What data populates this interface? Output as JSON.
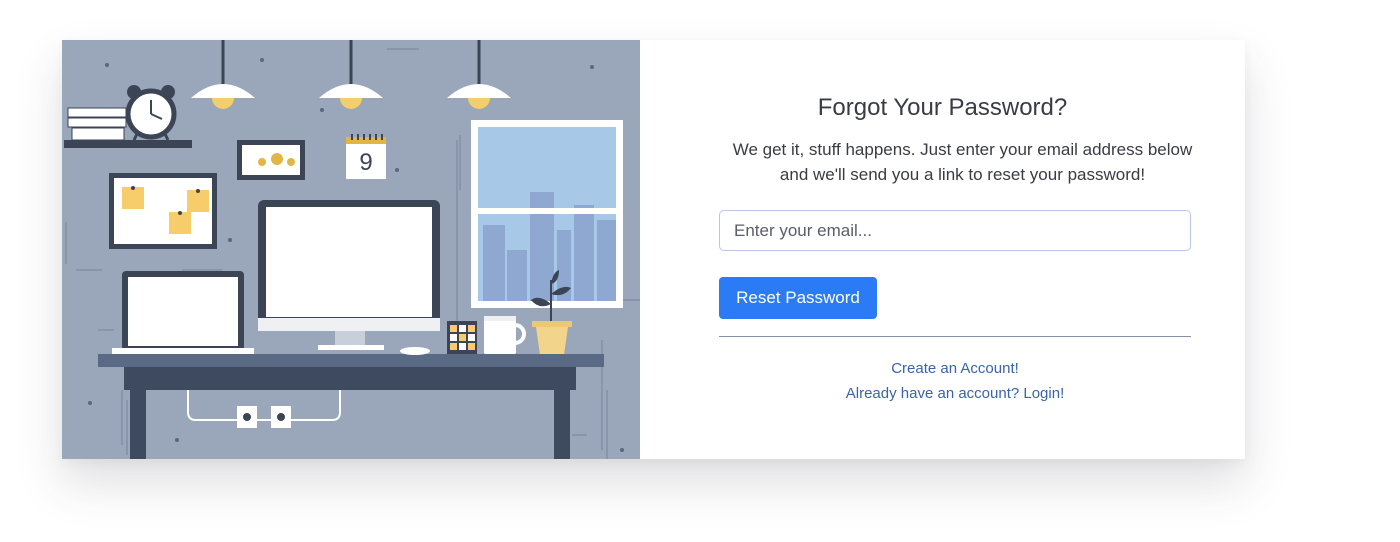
{
  "page": {
    "title": "Forgot Your Password?",
    "subtitle": "We get it, stuff happens. Just enter your email address below and we'll send you a link to reset your password!"
  },
  "form": {
    "email_placeholder": "Enter your email...",
    "submit_label": "Reset Password"
  },
  "links": {
    "create_account": "Create an Account!",
    "login": "Already have an account? Login!"
  },
  "illustration": {
    "calendar_day": "9"
  },
  "colors": {
    "primary": "#2c7bf6",
    "link": "#3a64a8",
    "text": "#3a3b45",
    "illustration_bg": "#9aa6b9"
  }
}
